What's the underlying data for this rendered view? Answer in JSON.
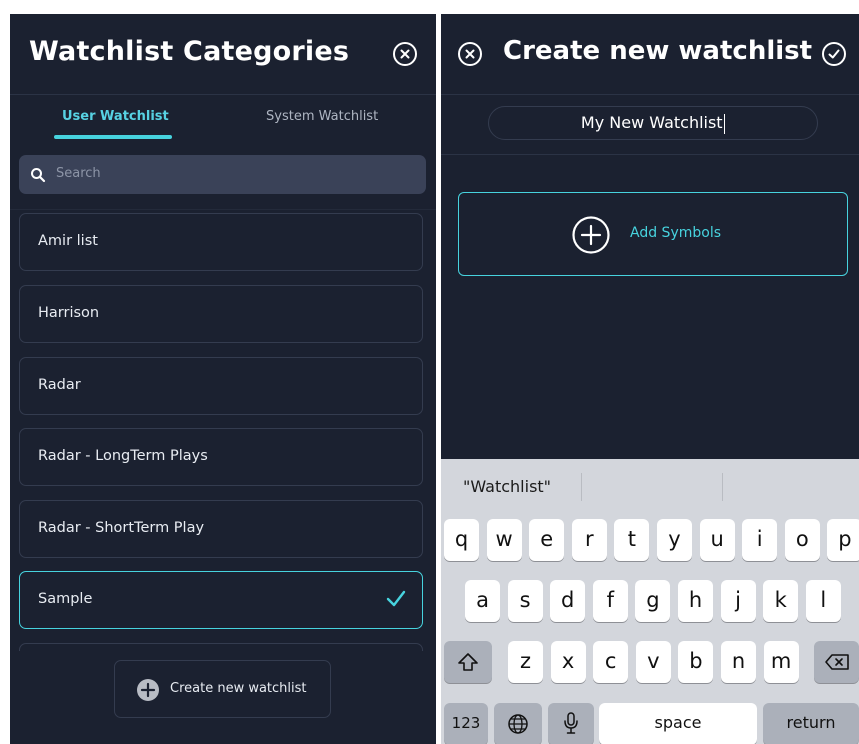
{
  "left": {
    "title": "Watchlist Categories",
    "tabs": [
      {
        "label": "User Watchlist",
        "active": true
      },
      {
        "label": "System Watchlist",
        "active": false
      }
    ],
    "search": {
      "placeholder": "Search"
    },
    "items": [
      {
        "label": "Amir list",
        "selected": false
      },
      {
        "label": "Harrison",
        "selected": false
      },
      {
        "label": "Radar",
        "selected": false
      },
      {
        "label": "Radar - LongTerm Plays",
        "selected": false
      },
      {
        "label": "Radar - ShortTerm Play",
        "selected": false
      },
      {
        "label": "Sample",
        "selected": true
      }
    ],
    "create_button": "Create new watchlist"
  },
  "right": {
    "title": "Create new watchlist",
    "name_value": "My New Watchlist",
    "add_symbols": "Add Symbols"
  },
  "keyboard": {
    "suggestions": [
      "\"Watchlist\"",
      "",
      ""
    ],
    "row1": [
      "q",
      "w",
      "e",
      "r",
      "t",
      "y",
      "u",
      "i",
      "o",
      "p"
    ],
    "row2": [
      "a",
      "s",
      "d",
      "f",
      "g",
      "h",
      "j",
      "k",
      "l"
    ],
    "row3": [
      "z",
      "x",
      "c",
      "v",
      "b",
      "n",
      "m"
    ],
    "numbers_key": "123",
    "space_key": "space",
    "return_key": "return"
  },
  "colors": {
    "background": "#1b2130",
    "accent": "#47d3de",
    "card_border": "#343c4f",
    "search_bg": "#3a4258",
    "keyboard_bg": "#d3d6dc"
  },
  "icons": [
    "close-icon",
    "search-icon",
    "check-icon",
    "plus-circle-icon",
    "confirm-check-icon",
    "shift-icon",
    "globe-icon",
    "microphone-icon",
    "backspace-icon"
  ]
}
